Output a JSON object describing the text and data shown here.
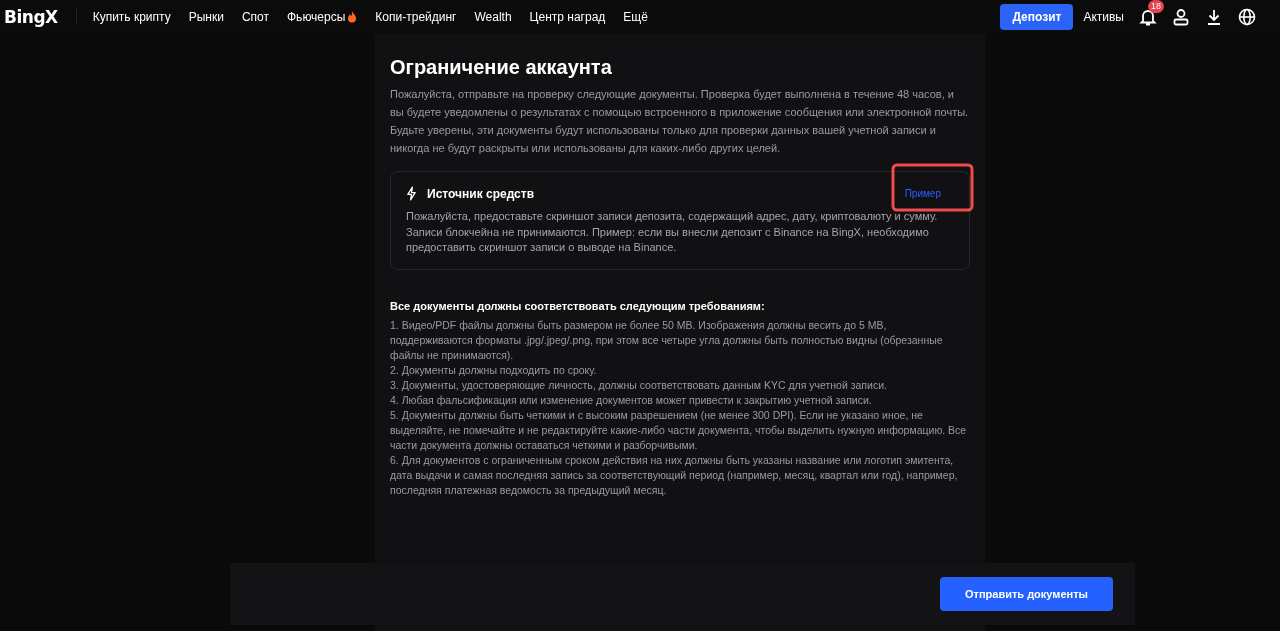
{
  "header": {
    "logo": "BingX",
    "nav": [
      {
        "label": "Купить крипту",
        "hot": false
      },
      {
        "label": "Рынки",
        "hot": false
      },
      {
        "label": "Спот",
        "hot": false
      },
      {
        "label": "Фьючерсы",
        "hot": true
      },
      {
        "label": "Копи-трейдинг",
        "hot": false
      },
      {
        "label": "Wealth",
        "hot": false
      },
      {
        "label": "Центр наград",
        "hot": false
      },
      {
        "label": "Ещё",
        "hot": false
      }
    ],
    "deposit_button": "Депозит",
    "assets_link": "Активы",
    "notification_badge": "18"
  },
  "title": "Ограничение аккаунта",
  "intro": "Пожалуйста, отправьте на проверку следующие документы. Проверка будет выполнена в течение 48 часов, и вы будете уведомлены о результатах с помощью встроенного в приложение сообщения или электронной почты. Будьте уверены, эти документы будут использованы только для проверки данных вашей учетной записи и никогда не будут раскрыты или использованы для каких-либо других целей.",
  "card": {
    "title": "Источник средств",
    "example_link": "Пример",
    "text": "Пожалуйста, предоставьте скриншот записи депозита, содержащий адрес, дату, криптовалюту и сумму. Записи блокчейна не принимаются. Пример: если вы внесли депозит с Binance на BingX, необходимо предоставить скриншот записи о выводе на Binance."
  },
  "requirements": {
    "heading": "Все документы должны соответствовать следующим требованиям:",
    "items": [
      "1. Видео/PDF файлы должны быть размером не более 50 MB. Изображения должны весить до 5 MB, поддерживаются форматы .jpg/.jpeg/.png, при этом все четыре угла должны быть полностью видны (обрезанные файлы не принимаются).",
      "2. Документы должны подходить по сроку.",
      "3. Документы, удостоверяющие личность, должны соответствовать данным KYC для учетной записи.",
      "4. Любая фальсификация или изменение документов может привести к закрытию учетной записи.",
      "5. Документы должны быть четкими и с высоким разрешением (не менее 300 DPI). Если не указано иное, не выделяйте, не помечайте и не редактируйте какие-либо части документа, чтобы выделить нужную информацию. Все части документа должны оставаться четкими и разборчивыми.",
      "6. Для документов с ограниченным сроком действия на них должны быть указаны название или логотип эмитента, дата выдачи и самая последняя запись за соответствующий период (например, месяц, квартал или год), например, последняя платежная ведомость за предыдущий месяц."
    ]
  },
  "submit_button": "Отправить документы"
}
